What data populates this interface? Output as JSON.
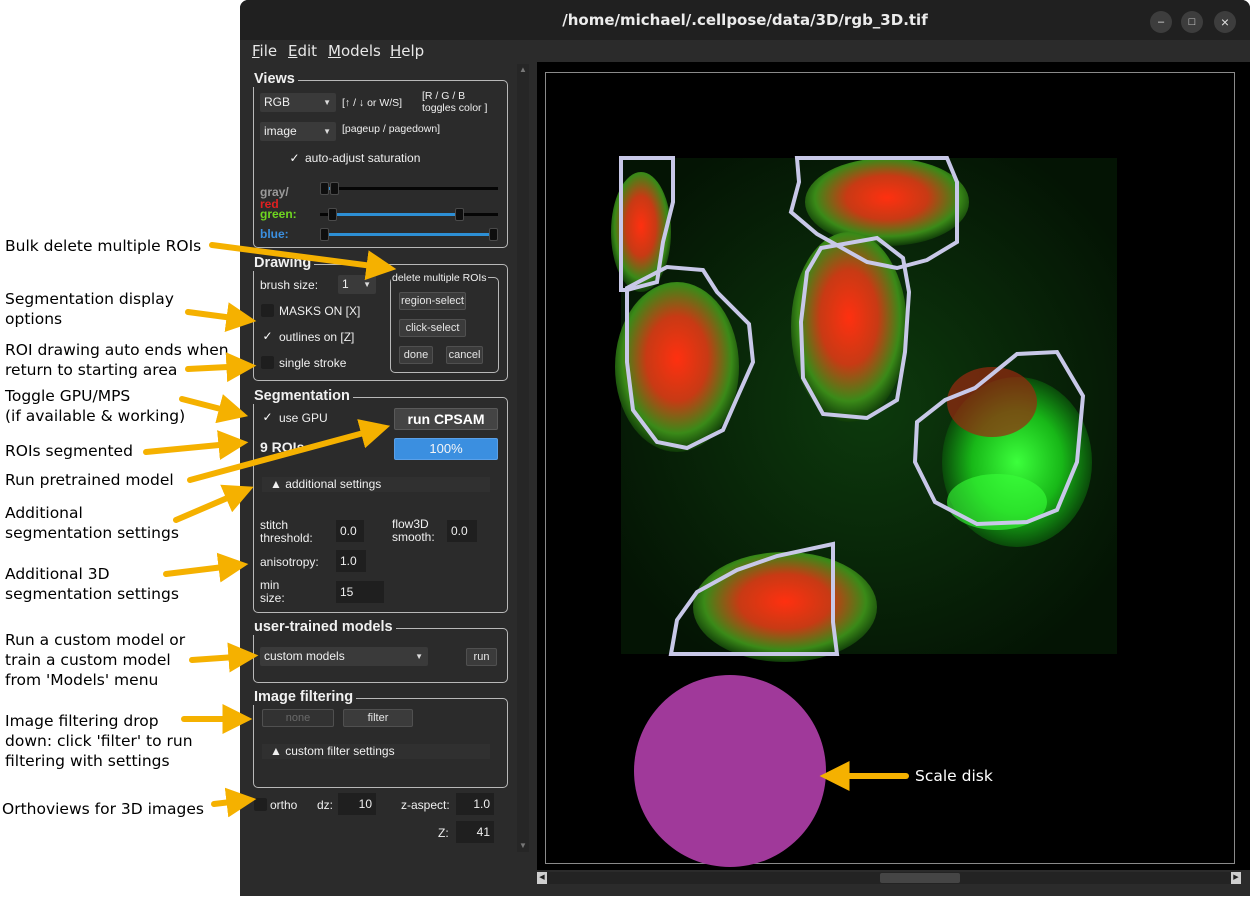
{
  "window": {
    "title": "/home/michael/.cellpose/data/3D/rgb_3D.tif",
    "controls": {
      "minimize": "–",
      "maximize": "□",
      "close": "×"
    }
  },
  "menu": [
    "File",
    "Edit",
    "Models",
    "Help"
  ],
  "views": {
    "title": "Views",
    "color_mode": "RGB",
    "color_hint": "[↑ / ↓ or W/S]",
    "toggle_hint": "[R / G / B\n toggles color ]",
    "layer": "image",
    "layer_hint": "[pageup / pagedown]",
    "auto_adjust_label": "auto-adjust saturation",
    "auto_adjust_checked": true,
    "channels": [
      {
        "label": "gray/",
        "label2": "red",
        "label_color": "#9a9a9a",
        "label2_color": "#e02020",
        "low": 0.0,
        "high": 0.06
      },
      {
        "label": "green:",
        "label_color": "#6fd620",
        "low": 0.05,
        "high": 0.8
      },
      {
        "label": "blue:",
        "label_color": "#3b8fe0",
        "low": 0.0,
        "high": 1.0
      }
    ]
  },
  "drawing": {
    "title": "Drawing",
    "brush_label": "brush size:",
    "brush_value": "1",
    "masks_label": "MASKS ON [X]",
    "masks_checked": false,
    "outlines_label": "outlines on [Z]",
    "outlines_checked": true,
    "single_stroke_label": "single stroke",
    "single_stroke_checked": false,
    "delete_group_title": "delete multiple ROIs",
    "region_select": "region-select",
    "click_select": "click-select",
    "done": "done",
    "cancel": "cancel"
  },
  "segmentation": {
    "title": "Segmentation",
    "use_gpu_label": "use GPU",
    "use_gpu_checked": true,
    "run_button": "run CPSAM",
    "roi_count": "9 ROIs",
    "progress_text": "100%",
    "progress": 1.0,
    "additional_settings": "▲ additional settings",
    "stitch_label": "stitch\nthreshold:",
    "stitch_value": "0.0",
    "flow3d_label": "flow3D\nsmooth:",
    "flow3d_value": "0.0",
    "anisotropy_label": "anisotropy:",
    "anisotropy_value": "1.0",
    "min_size_label": "min\nsize:",
    "min_size_value": "15"
  },
  "user_models": {
    "title": "user-trained models",
    "selected": "custom models",
    "run": "run"
  },
  "filtering": {
    "title": "Image filtering",
    "selected": "none",
    "filter_button": "filter",
    "custom_settings": "▲ custom filter settings"
  },
  "ortho": {
    "label": "ortho",
    "checked": false,
    "dz_label": "dz:",
    "dz_value": "10",
    "zaspect_label": "z-aspect:",
    "zaspect_value": "1.0",
    "z_label": "Z:",
    "z_value": "41"
  },
  "annotations": {
    "bulk_delete": "Bulk delete multiple ROIs",
    "seg_display": "Segmentation display\noptions",
    "roi_drawing": "ROI drawing auto ends when\nreturn to starting area",
    "toggle_gpu": "Toggle GPU/MPS\n(if available & working)",
    "rois_segmented": "ROIs segmented",
    "run_pretrained": "Run pretrained model",
    "additional": "Additional\nsegmentation settings",
    "additional_3d": "Additional 3D\nsegmentation settings",
    "custom_model": "Run a custom model or\ntrain a custom model\nfrom 'Models' menu",
    "filtering": "Image filtering drop\ndown: click 'filter' to run\nfiltering with settings",
    "orthoviews": "Orthoviews for 3D images",
    "scale_disk": "Scale disk"
  },
  "colors": {
    "arrow": "#f5b100",
    "accent_blue": "#3b8fe0",
    "scale_disk": "#a0399a",
    "outline": "#c8c8e8"
  }
}
